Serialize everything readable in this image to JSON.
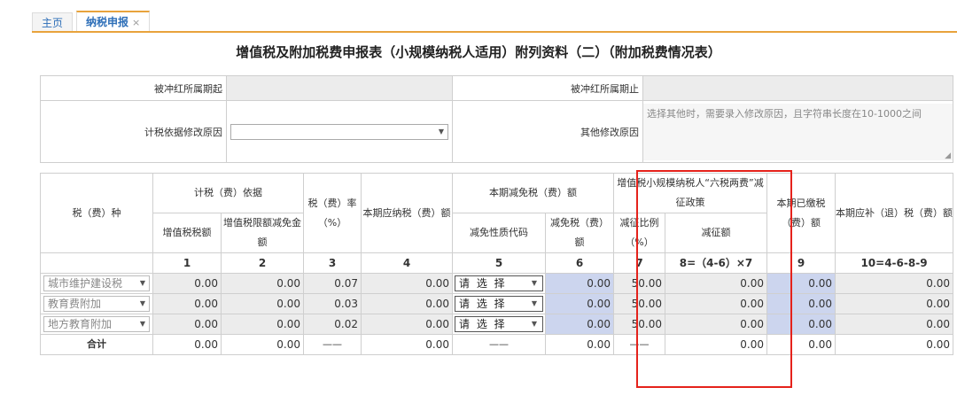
{
  "tabs": [
    {
      "label": "主页"
    },
    {
      "label": "纳税申报",
      "close": "×"
    }
  ],
  "title": "增值税及附加税费申报表（小规模纳税人适用）附列资料（二）（附加税费情况表）",
  "header": {
    "period_start_label": "被冲红所属期起",
    "period_end_label": "被冲红所属期止",
    "basis_reason_label": "计税依据修改原因",
    "other_reason_label": "其他修改原因",
    "other_reason_placeholder": "选择其他时，需要录入修改原因，且字符串长度在10-1000之间"
  },
  "table": {
    "h_tax_type": "税（费）种",
    "h_basis": "计税（费）依据",
    "h_vat": "增值税税额",
    "h_vat_limit": "增值税限额减免金额",
    "h_rate": "税（费）率（%）",
    "h_payable": "本期应纳税（费）额",
    "h_relief": "本期减免税（费）额",
    "h_relief_code": "减免性质代码",
    "h_relief_amount": "减免税（费）额",
    "h_policy": "增值税小规模纳税人“六税两费”减征政策",
    "h_policy_ratio": "减征比例（%）",
    "h_policy_amount": "减征额",
    "h_paid": "本期已缴税（费）额",
    "h_due": "本期应补（退）税（费）额",
    "colnums": [
      "1",
      "2",
      "3",
      "4",
      "5",
      "6",
      "7",
      "8=（4-6）×7",
      "9",
      "10=4-6-8-9"
    ],
    "select_placeholder": "请 选 择",
    "rows": [
      {
        "name": "城市维护建设税",
        "c1": "0.00",
        "c2": "0.00",
        "c3": "0.07",
        "c4": "0.00",
        "c6": "0.00",
        "c7": "50.00",
        "c8": "0.00",
        "c9": "0.00",
        "c10": "0.00"
      },
      {
        "name": "教育费附加",
        "c1": "0.00",
        "c2": "0.00",
        "c3": "0.03",
        "c4": "0.00",
        "c6": "0.00",
        "c7": "50.00",
        "c8": "0.00",
        "c9": "0.00",
        "c10": "0.00"
      },
      {
        "name": "地方教育附加",
        "c1": "0.00",
        "c2": "0.00",
        "c3": "0.02",
        "c4": "0.00",
        "c6": "0.00",
        "c7": "50.00",
        "c8": "0.00",
        "c9": "0.00",
        "c10": "0.00"
      }
    ],
    "total": {
      "label": "合计",
      "c1": "0.00",
      "c2": "0.00",
      "c3": "——",
      "c4": "0.00",
      "c5": "——",
      "c6": "0.00",
      "c7": "——",
      "c8": "0.00",
      "c9": "0.00",
      "c10": "0.00"
    }
  },
  "icons": {
    "dropdown": "▼",
    "resize": "◢"
  },
  "colors": {
    "accent": "#e8a33c",
    "link": "#2e6fb8",
    "highlight": "#e5221b",
    "blue_cell": "#ccd5ee"
  }
}
